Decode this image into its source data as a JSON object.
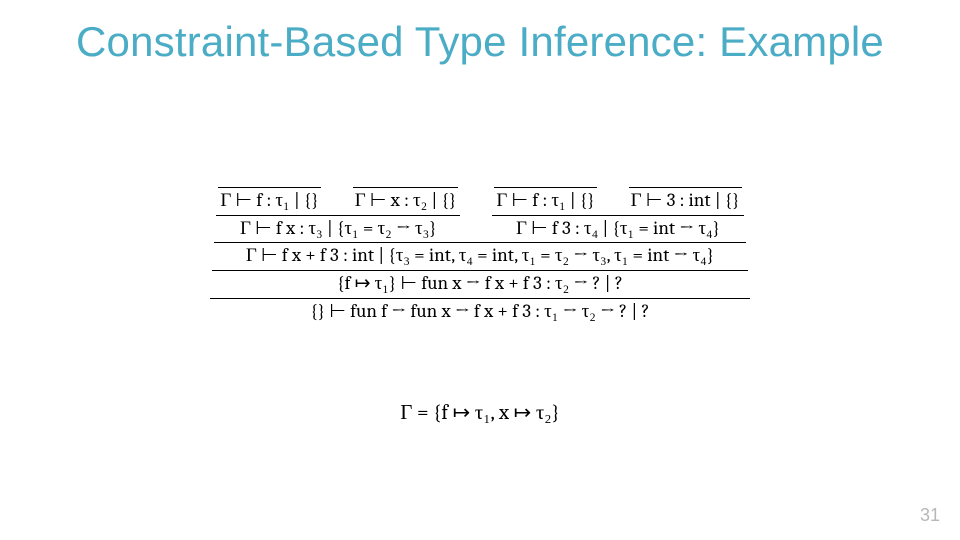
{
  "title": "Constraint-Based Type Inference: Example",
  "axioms": {
    "f_tau1": "Γ ⊢ f : τ₁ | {}",
    "x_tau2": "Γ ⊢ x : τ₂ | {}",
    "f_tau1_b": "Γ ⊢ f : τ₁ | {}",
    "three_int": "Γ ⊢ 3 : int | {}"
  },
  "derivs": {
    "fx": "Γ ⊢ f x : τ₃ | {τ₁ = τ₂ → τ₃}",
    "f3": "Γ ⊢ f 3 : τ₄ | {τ₁ = int → τ₄}",
    "sum": "Γ ⊢ f x + f 3 : int | {τ₃ = int, τ₄ = int, τ₁ = τ₂ → τ₃, τ₁ = int → τ₄}",
    "funx": "{f ↦ τ₁} ⊢ fun x → f x + f 3 : τ₂ → ? | ?",
    "funf": "{} ⊢ fun f → fun x → f x + f 3 : τ₁ → τ₂ → ? | ?"
  },
  "gamma": "Γ = {f ↦ τ₁, x ↦ τ₂}",
  "page": "31"
}
